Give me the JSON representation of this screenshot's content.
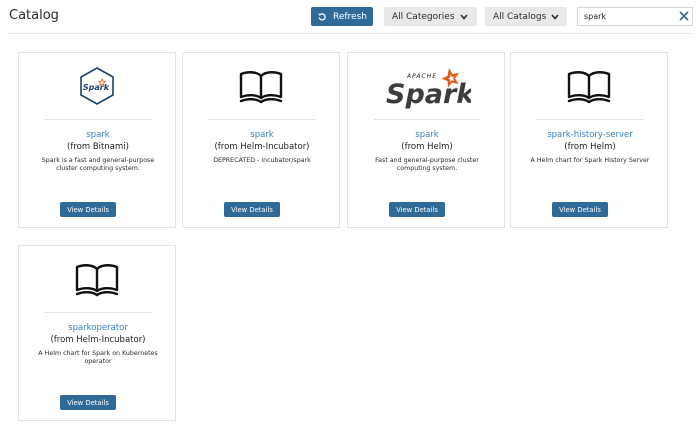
{
  "header": {
    "title": "Catalog",
    "refresh_label": "Refresh",
    "categories_label": "All Categories",
    "catalogs_label": "All Catalogs",
    "search_value": "spark"
  },
  "cards": [
    {
      "name": "spark",
      "source": "(from Bitnami)",
      "description": "Spark is a fast and general-purpose cluster computing system.",
      "button": "View Details",
      "logo_text": "Spark",
      "icon": "bitnami-spark-logo"
    },
    {
      "name": "spark",
      "source": "(from Helm-Incubator)",
      "description": "DEPRECATED - incubator/spark",
      "button": "View Details",
      "icon": "book-icon"
    },
    {
      "name": "spark",
      "source": "(from Helm)",
      "description": "Fast and general-purpose cluster computing system.",
      "button": "View Details",
      "logo_text": "Spark",
      "logo_subtext": "APACHE",
      "icon": "apache-spark-logo"
    },
    {
      "name": "spark-history-server",
      "source": "(from Helm)",
      "description": "A Helm chart for Spark History Server",
      "button": "View Details",
      "icon": "book-icon"
    },
    {
      "name": "sparkoperator",
      "source": "(from Helm-Incubator)",
      "description": "A Helm chart for Spark on Kubernetes operator",
      "button": "View Details",
      "icon": "book-icon"
    }
  ],
  "colors": {
    "primary_button": "#2f6a99",
    "link": "#3a82c2",
    "spark_orange": "#e25a1c"
  }
}
